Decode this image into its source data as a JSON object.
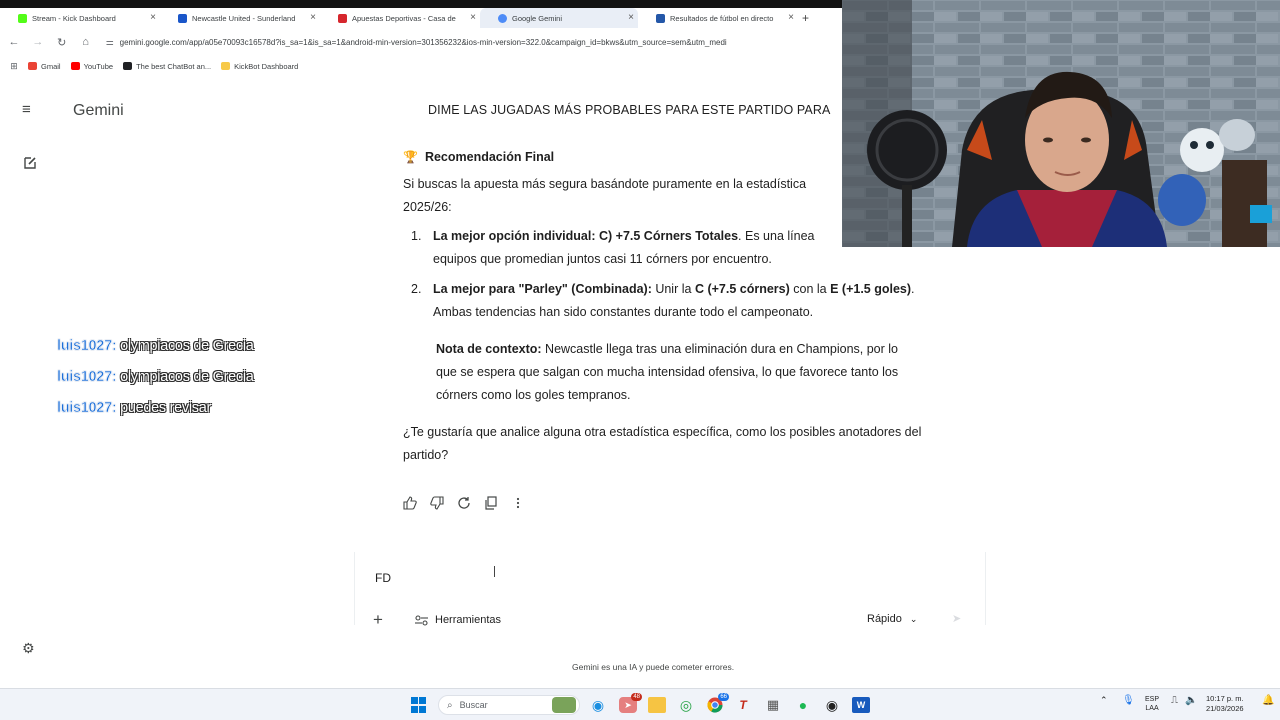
{
  "browser": {
    "tabs": [
      {
        "title": "Stream - Kick Dashboard",
        "color": "#53fc18",
        "active": false
      },
      {
        "title": "Newcastle United - Sunderland",
        "color": "#1a56c9",
        "active": false
      },
      {
        "title": "Apuestas Deportivas - Casa de",
        "color": "#d6262d",
        "active": false
      },
      {
        "title": "Google Gemini",
        "color": "#4e8cf7",
        "active": true
      },
      {
        "title": "Resultados de fútbol en directo",
        "color": "#2457a8",
        "active": false
      }
    ],
    "new_tab": "+",
    "url": "gemini.google.com/app/a05e70093c16578d?is_sa=1&is_sa=1&android-min-version=301356232&ios-min-version=322.0&campaign_id=bkws&utm_source=sem&utm_medi",
    "bookmarks": [
      {
        "label": "Gmail",
        "color": "#ea4335"
      },
      {
        "label": "YouTube",
        "color": "#ff0000"
      },
      {
        "label": "The best ChatBot an...",
        "color": "#202124"
      },
      {
        "label": "KickBot Dashboard",
        "color": "#f7c948"
      }
    ]
  },
  "app": {
    "title": "Gemini",
    "chat_title": "DIME LAS JUGADAS MÁS PROBABLES PARA ESTE PARTIDO PARA"
  },
  "response": {
    "heading": "Recomendación Final",
    "intro_1": "Si buscas la apuesta más segura basándote puramente en la estadística",
    "intro_2": "2025/26:",
    "items": [
      {
        "num": "1.",
        "bold": "La mejor opción individual: C) +7.5 Córners Totales",
        "line1_rest": ". Es una línea",
        "line2": "equipos que promedian juntos casi 11 córners por encuentro."
      },
      {
        "num": "2.",
        "bold": "La mejor para \"Parley\" (Combinada):",
        "mid1": " Unir la ",
        "bold2": "C (+7.5 córners)",
        "mid2": " con la ",
        "bold3": "E (+1.5 goles)",
        "end": ".",
        "line2": "Ambas tendencias han sido constantes durante todo el campeonato."
      }
    ],
    "note_label": "Nota de contexto:",
    "note_line1": " Newcastle llega tras una eliminación dura en Champions, por lo",
    "note_line2": "que se espera que salgan con mucha intensidad ofensiva, lo que favorece tanto los",
    "note_line3": "córners como los goles tempranos.",
    "closing_1": "¿Te gustaría que analice alguna otra estadística específica, como los posibles anotadores del",
    "closing_2": "partido?"
  },
  "composer": {
    "text": "FD",
    "tools_label": "Herramientas",
    "mode_label": "Rápido"
  },
  "disclaimer": "Gemini es una IA y puede cometer errores.",
  "overlay_chat": [
    {
      "user": "luis1027:",
      "message": "olympiacos de Grecia"
    },
    {
      "user": "luis1027:",
      "message": "olympiacos de Grecia"
    },
    {
      "user": "luis1027:",
      "message": "puedes revisar"
    }
  ],
  "taskbar": {
    "search_placeholder": "Buscar",
    "badge_1": "48",
    "badge_2": "66",
    "lang_1": "ESP",
    "lang_2": "LAA",
    "time": "10:17 p. m.",
    "date": "21/03/2026"
  }
}
